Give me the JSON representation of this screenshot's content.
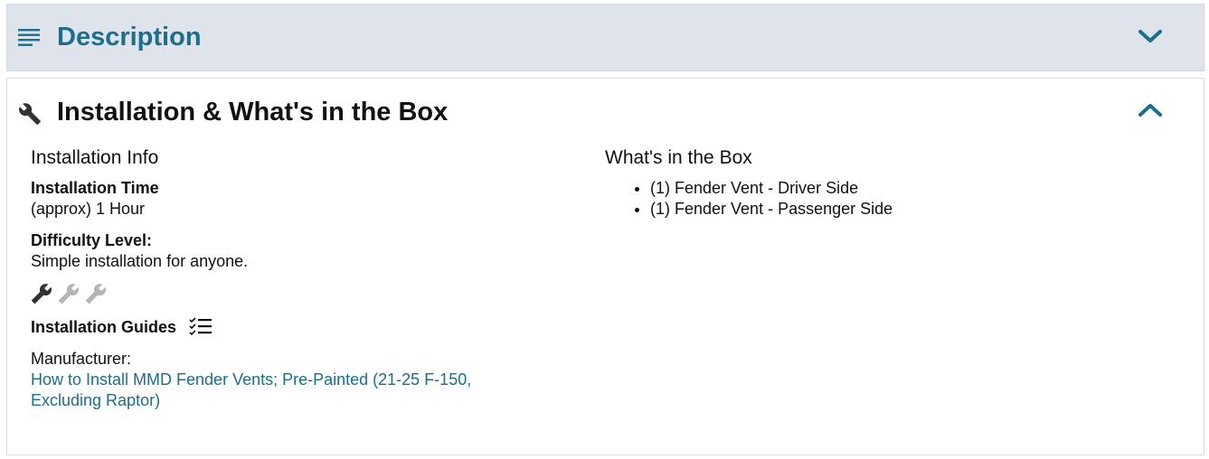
{
  "description_panel": {
    "title": "Description",
    "icon": "lines-icon",
    "toggle_icon": "chevron-down-icon"
  },
  "install_panel": {
    "title": "Installation & What's in the Box",
    "icon": "wrench-icon",
    "toggle_icon": "chevron-up-icon",
    "installation_info": {
      "heading": "Installation Info",
      "time_label": "Installation Time",
      "time_value": "(approx) 1 Hour",
      "difficulty_label": "Difficulty Level:",
      "difficulty_value": "Simple installation for anyone.",
      "difficulty_rating": 1,
      "difficulty_max": 3,
      "guides_label": "Installation Guides",
      "guides_icon": "checklist-icon",
      "manufacturer_label": "Manufacturer:",
      "guide_link_text": "How to Install MMD Fender Vents; Pre-Painted (21-25 F-150, Excluding Raptor)"
    },
    "whats_in_box": {
      "heading": "What's in the Box",
      "items": [
        "(1) Fender Vent - Driver Side",
        "(1) Fender Vent - Passenger Side"
      ]
    }
  },
  "colors": {
    "accent": "#1b6e8c",
    "panel_bg": "#dfe3ec",
    "wrench_active": "#333333",
    "wrench_inactive": "#b5b5b5"
  }
}
